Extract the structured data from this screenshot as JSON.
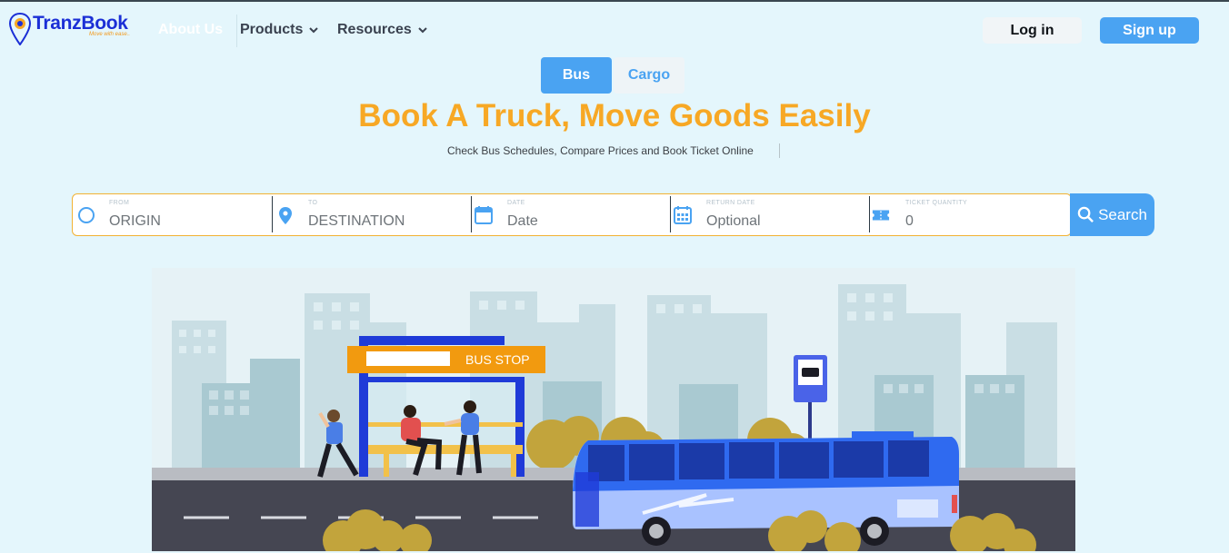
{
  "header": {
    "logo_name": "TranzBook",
    "logo_tagline": "Move with ease..",
    "nav_about": "About Us",
    "nav_products": "Products",
    "nav_resources": "Resources",
    "login": "Log in",
    "signup": "Sign up"
  },
  "tabs": {
    "bus": "Bus",
    "cargo": "Cargo"
  },
  "hero": {
    "title": "Book A Truck, Move Goods Easily",
    "subtitle": "Check Bus Schedules, Compare Prices and Book Ticket Online"
  },
  "search": {
    "from_label": "FROM",
    "from_placeholder": "ORIGIN",
    "to_label": "TO",
    "to_placeholder": "DESTINATION",
    "date_label": "DATE",
    "date_placeholder": "Date",
    "return_label": "RETURN DATE",
    "return_placeholder": "Optional",
    "qty_label": "TICKET QUANTITY",
    "qty_value": "0",
    "button": "Search"
  },
  "illustration": {
    "sign_text": "BUS STOP"
  },
  "colors": {
    "accent": "#4aa3f2",
    "brand": "#1b2fd6",
    "title": "#f7a825",
    "background": "#e4f6fc"
  }
}
